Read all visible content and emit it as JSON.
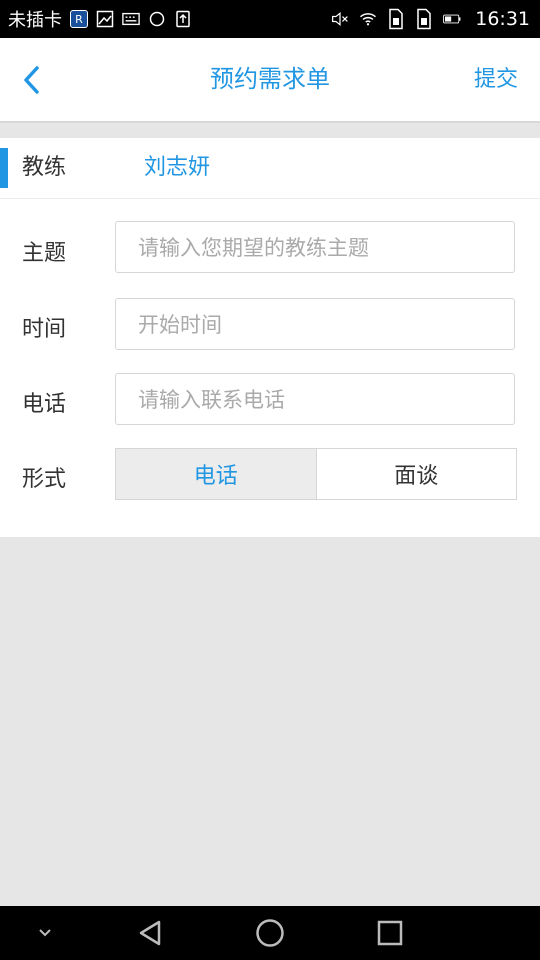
{
  "status_bar": {
    "carrier": "未插卡",
    "r_badge": "R",
    "time": "16:31",
    "icons": [
      "r-badge-icon",
      "image-icon",
      "keyboard-icon",
      "circle-icon",
      "upload-icon",
      "mute-icon",
      "wifi-icon",
      "sim1-icon",
      "sim2-icon",
      "battery-icon"
    ]
  },
  "header": {
    "title": "预约需求单",
    "submit_label": "提交",
    "back_icon": "chevron-left-icon"
  },
  "coach": {
    "label": "教练",
    "value": "刘志妍"
  },
  "form": {
    "topic": {
      "label": "主题",
      "placeholder": "请输入您期望的教练主题"
    },
    "time": {
      "label": "时间",
      "placeholder": "开始时间"
    },
    "phone": {
      "label": "电话",
      "placeholder": "请输入联系电话"
    },
    "mode": {
      "label": "形式",
      "options": [
        "电话",
        "面谈"
      ],
      "selected": "电话"
    }
  },
  "nav_bar": {
    "icons": [
      "chevron-down-icon",
      "back-triangle-icon",
      "home-circle-icon",
      "recents-square-icon"
    ]
  },
  "colors": {
    "accent": "#2196e3",
    "background": "#e6e6e6",
    "text": "#333333",
    "placeholder": "#aaaaaa"
  }
}
